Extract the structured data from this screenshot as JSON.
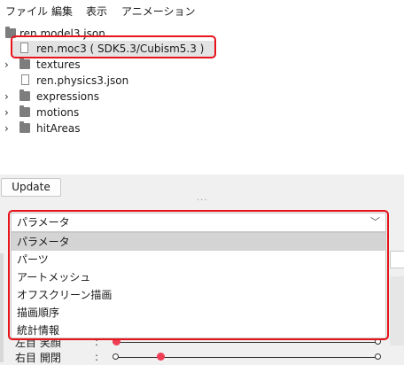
{
  "menu": {
    "items": [
      "ファイル",
      "編集",
      "表示",
      "アニメーション"
    ]
  },
  "tree": {
    "root": "ren.model3.json",
    "moc": "ren.moc3 ( SDK5.3/Cubism5.3 )",
    "textures": "textures",
    "physics": "ren.physics3.json",
    "expressions": "expressions",
    "motions": "motions",
    "hitAreas": "hitAreas"
  },
  "update_button": "Update",
  "splitter_handle": "...",
  "combo": {
    "selected": "パラメータ",
    "options": [
      "パラメータ",
      "パーツ",
      "アートメッシュ",
      "オフスクリーン描画",
      "描画順序",
      "統計情報"
    ]
  },
  "params": [
    {
      "label": "左目 笑顔",
      "colon": ":",
      "value": 0.0
    },
    {
      "label": "右目 開閉",
      "colon": ":",
      "value": 0.17
    }
  ],
  "colors": {
    "highlight": "#e8131b",
    "slider_knob": "#ef3e55"
  }
}
